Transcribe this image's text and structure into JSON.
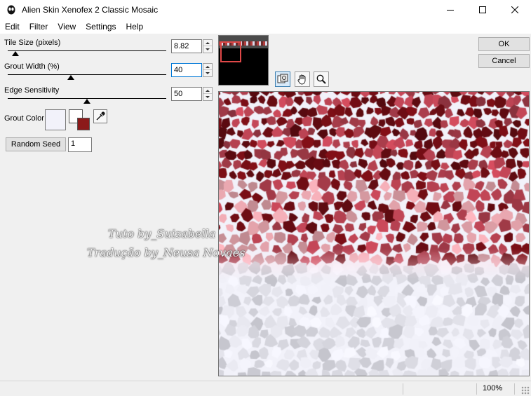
{
  "window": {
    "title": "Alien Skin Xenofex 2 Classic Mosaic"
  },
  "menu": {
    "items": [
      "Edit",
      "Filter",
      "View",
      "Settings",
      "Help"
    ]
  },
  "params": {
    "tile_size": {
      "label": "Tile Size (pixels)",
      "value": "8.82",
      "level": 0.05
    },
    "grout_width": {
      "label": "Grout Width (%)",
      "value": "40",
      "level": 0.4
    },
    "edge_sensitivity": {
      "label": "Edge Sensitivity",
      "value": "50",
      "level": 0.5
    }
  },
  "grout_color": {
    "label": "Grout Color",
    "swatch": "#f2f2fa",
    "foreground": "#ffffff",
    "background": "#8c1a1a"
  },
  "seed": {
    "button_label": "Random Seed",
    "value": "1"
  },
  "dialog": {
    "ok_label": "OK",
    "cancel_label": "Cancel"
  },
  "tools": [
    "preview-toggle-icon",
    "hand-icon",
    "magnifier-icon"
  ],
  "watermark": {
    "line1": "Tuto by_Suizabella",
    "line2": "Tradução by_Neusa Novaes"
  },
  "status": {
    "zoom": "100%"
  },
  "colors": {
    "tile_dark": "#6e0d14",
    "tile_mid": "#b44150",
    "tile_light": "#dfa0a8",
    "grout_light": "#f2f2fa"
  }
}
